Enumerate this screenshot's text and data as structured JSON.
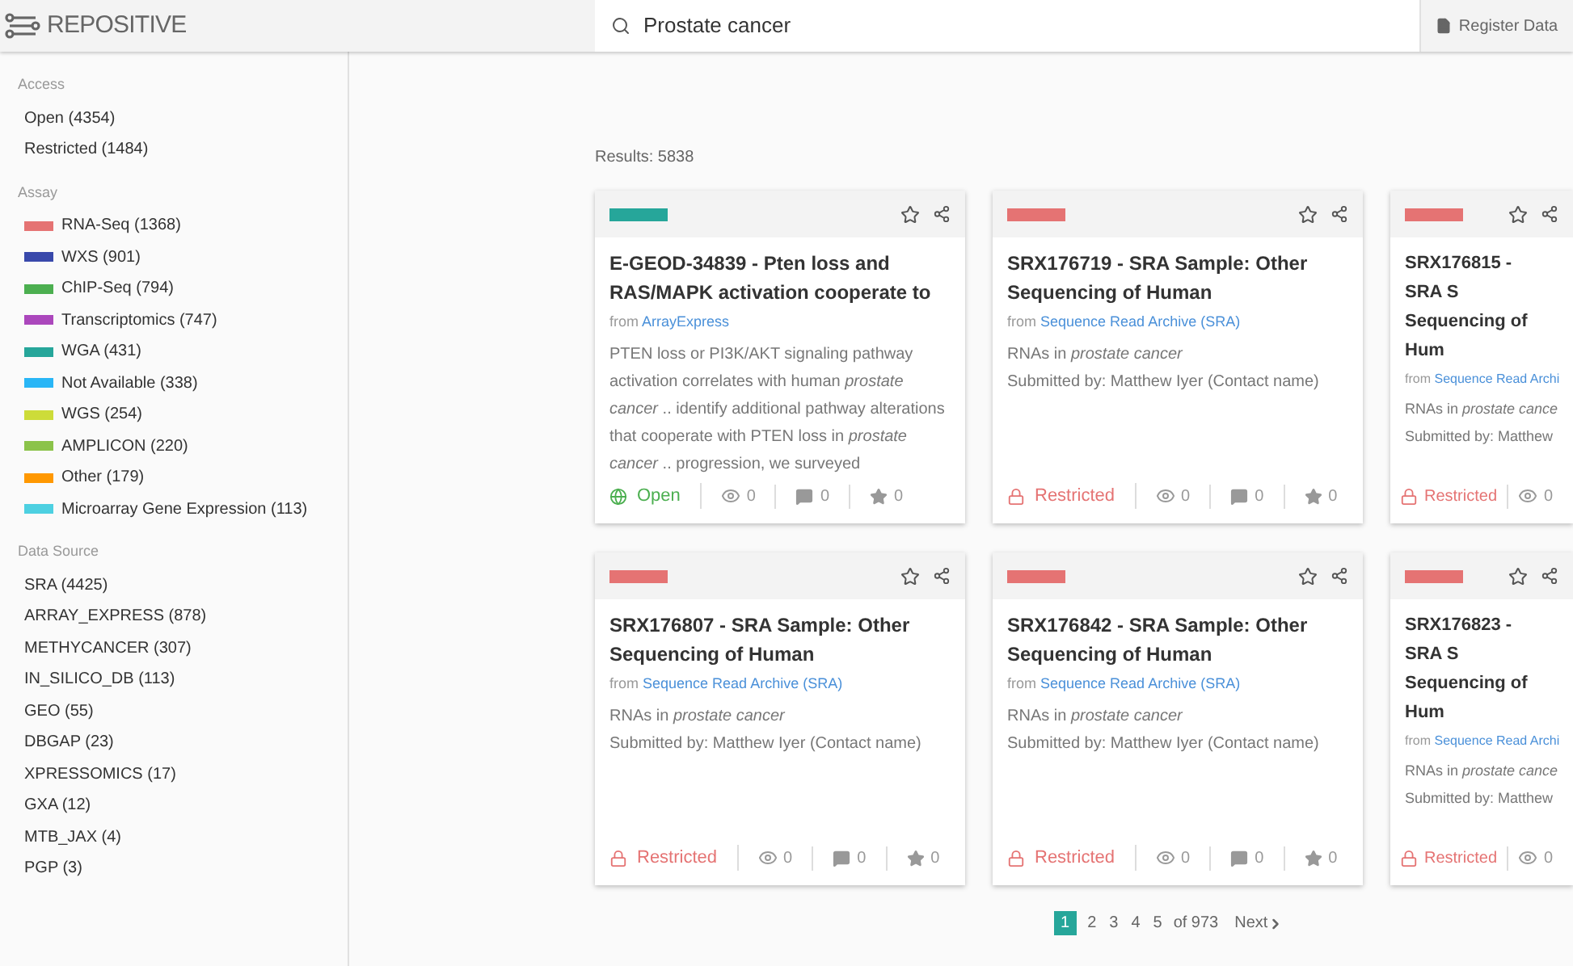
{
  "header": {
    "logo": "REPOSITIVE",
    "search": {
      "value": "Prostate cancer"
    },
    "register_button": "Register Data"
  },
  "sidebar": {
    "sections": [
      {
        "title": "Access",
        "items": [
          {
            "label": "Open (4354)"
          },
          {
            "label": "Restricted (1484)"
          }
        ]
      },
      {
        "title": "Assay",
        "items": [
          {
            "label": "RNA-Seq (1368)",
            "color": "#e57373"
          },
          {
            "label": "WXS (901)",
            "color": "#3949ab"
          },
          {
            "label": "ChIP-Seq (794)",
            "color": "#4caf50"
          },
          {
            "label": "Transcriptomics (747)",
            "color": "#ab47bc"
          },
          {
            "label": "WGA (431)",
            "color": "#26a69a"
          },
          {
            "label": "Not Available (338)",
            "color": "#29b6f6"
          },
          {
            "label": "WGS (254)",
            "color": "#cddc39"
          },
          {
            "label": "AMPLICON (220)",
            "color": "#8bc34a"
          },
          {
            "label": "Other (179)",
            "color": "#ff9800"
          },
          {
            "label": "Microarray Gene Expression (113)",
            "color": "#4dd0e1"
          }
        ]
      },
      {
        "title": "Data Source",
        "items": [
          {
            "label": "SRA (4425)"
          },
          {
            "label": "ARRAY_EXPRESS (878)"
          },
          {
            "label": "METHYCANCER (307)"
          },
          {
            "label": "IN_SILICO_DB (113)"
          },
          {
            "label": "GEO (55)"
          },
          {
            "label": "DBGAP (23)"
          },
          {
            "label": "XPRESSOMICS (17)"
          },
          {
            "label": "GXA (12)"
          },
          {
            "label": "MTB_JAX (4)"
          },
          {
            "label": "PGP (3)"
          }
        ]
      }
    ]
  },
  "results_label": "Results: 5838",
  "cards": [
    {
      "color": "#26a69a",
      "title": "E-GEOD-34839 - Pten loss and RAS/MAPK activation cooperate to",
      "from": "from",
      "source": "ArrayExpress",
      "lines": [
        "PTEN loss or PI3K/AKT signaling pathway activation correlates with human *prostate cancer* .. identify additional pathway alterations that cooperate with PTEN loss in *prostate cancer* .. progression, we surveyed"
      ],
      "access": {
        "kind": "open",
        "label": "Open"
      },
      "views": "0",
      "comments": "0",
      "stars": "0"
    },
    {
      "color": "#e57373",
      "title": "SRX176719 - SRA Sample: Other Sequencing of Human",
      "from": "from",
      "source": "Sequence Read Archive (SRA)",
      "lines": [
        "RNAs in *prostate cancer*",
        "Submitted by: Matthew Iyer (Contact name)"
      ],
      "access": {
        "kind": "restricted",
        "label": "Restricted"
      },
      "views": "0",
      "comments": "0",
      "stars": "0"
    },
    {
      "color": "#e57373",
      "title": "SRX176815 - SRA S Sequencing of Hum",
      "from": "from",
      "source": "Sequence Read Archi",
      "lines": [
        "RNAs in *prostate cance*",
        "Submitted by: Matthew"
      ],
      "access": {
        "kind": "restricted",
        "label": "Restricted"
      },
      "views": "0"
    },
    {
      "color": "#e57373",
      "title": "SRX176807 - SRA Sample: Other Sequencing of Human",
      "from": "from",
      "source": "Sequence Read Archive (SRA)",
      "lines": [
        "RNAs in *prostate cancer*",
        "Submitted by: Matthew Iyer (Contact name)"
      ],
      "access": {
        "kind": "restricted",
        "label": "Restricted"
      },
      "views": "0",
      "comments": "0",
      "stars": "0"
    },
    {
      "color": "#e57373",
      "title": "SRX176842 - SRA Sample: Other Sequencing of Human",
      "from": "from",
      "source": "Sequence Read Archive (SRA)",
      "lines": [
        "RNAs in *prostate cancer*",
        "Submitted by: Matthew Iyer (Contact name)"
      ],
      "access": {
        "kind": "restricted",
        "label": "Restricted"
      },
      "views": "0",
      "comments": "0",
      "stars": "0"
    },
    {
      "color": "#e57373",
      "title": "SRX176823 - SRA S Sequencing of Hum",
      "from": "from",
      "source": "Sequence Read Archi",
      "lines": [
        "RNAs in *prostate cance*",
        "Submitted by: Matthew"
      ],
      "access": {
        "kind": "restricted",
        "label": "Restricted"
      },
      "views": "0"
    }
  ],
  "pagination": {
    "pages": [
      {
        "label": "1",
        "selected": true
      },
      {
        "label": "2",
        "selected": false
      },
      {
        "label": "3",
        "selected": false
      },
      {
        "label": "4",
        "selected": false
      },
      {
        "label": "5",
        "selected": false
      }
    ],
    "total": "of 973",
    "next": "Next"
  }
}
